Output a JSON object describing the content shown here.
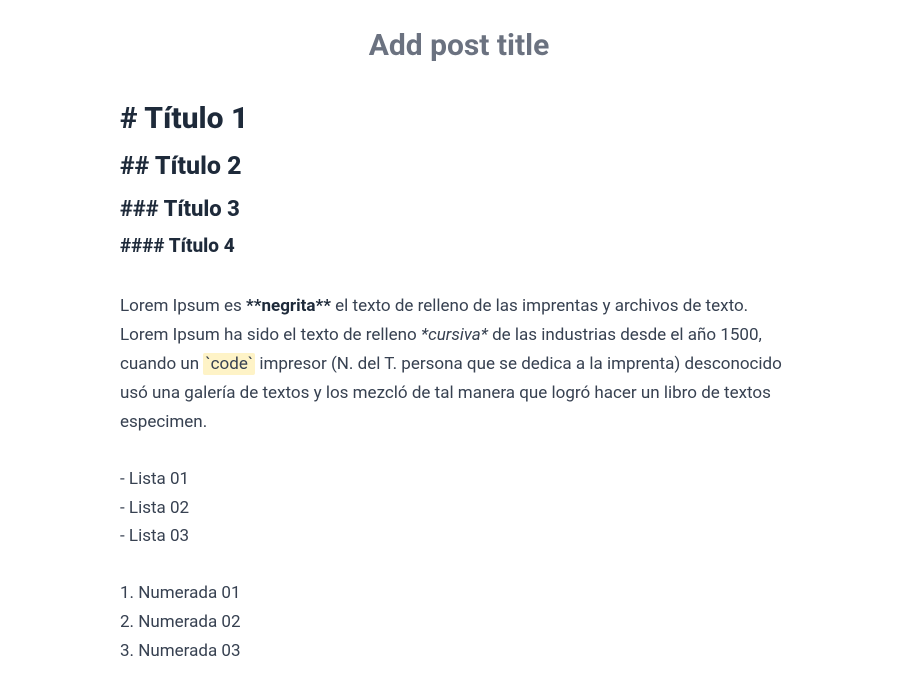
{
  "title": {
    "placeholder": "Add post title",
    "value": ""
  },
  "content": {
    "headings": {
      "h1": "# Título 1",
      "h2": "## Título 2",
      "h3": "### Título 3",
      "h4": "#### Título 4"
    },
    "paragraph": {
      "part1": "Lorem Ipsum es ",
      "bold": "**negrita**",
      "part2": " el texto de relleno de las imprentas y archivos de texto. Lorem Ipsum ha sido el texto de relleno ",
      "italic": "*cursiva*",
      "part3": " de las industrias desde el año 1500, cuando un ",
      "code": "`code`",
      "part4": " impresor (N. del T. persona que se dedica a la imprenta) desconocido usó una galería de textos y los mezcló de tal manera que logró hacer un libro de textos especimen."
    },
    "unordered": {
      "item1": "- Lista 01",
      "item2": "- Lista 02",
      "item3": "- Lista 03"
    },
    "ordered": {
      "item1": "1. Numerada 01",
      "item2": "2. Numerada 02",
      "item3": "3. Numerada 03"
    }
  }
}
